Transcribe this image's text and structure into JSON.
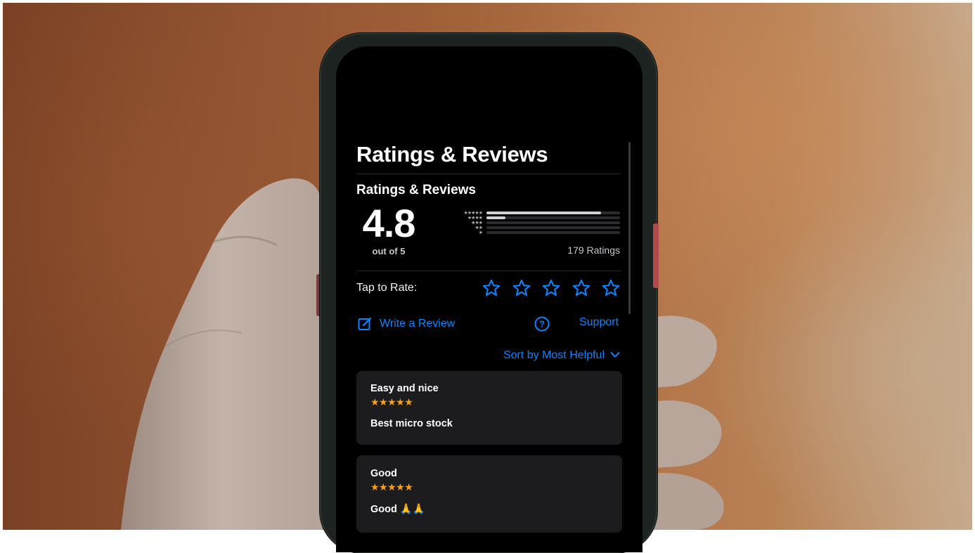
{
  "page": {
    "title": "Ratings & Reviews"
  },
  "ratings": {
    "section_title": "Ratings & Reviews",
    "average": "4.8",
    "out_of_label": "out of 5",
    "ratings_count": "179 Ratings",
    "distribution": [
      {
        "stars": 5,
        "fraction": 0.86
      },
      {
        "stars": 4,
        "fraction": 0.14
      },
      {
        "stars": 3,
        "fraction": 0.0
      },
      {
        "stars": 2,
        "fraction": 0.0
      },
      {
        "stars": 1,
        "fraction": 0.0
      }
    ]
  },
  "tap_to_rate": {
    "label": "Tap to Rate:",
    "star_count": 5
  },
  "actions": {
    "write_review": "Write a Review",
    "write_review_icon": "compose-icon",
    "support": "Support",
    "support_icon": "question-circle-icon"
  },
  "sort": {
    "label": "Sort by Most Helpful",
    "icon": "chevron-down-icon"
  },
  "reviews": [
    {
      "title": "Easy and nice",
      "stars": "★★★★★",
      "body": "Best micro stock"
    },
    {
      "title": "Good",
      "stars": "★★★★★",
      "body": "Good 🙏🙏"
    }
  ],
  "colors": {
    "accent": "#0a84ff",
    "star": "#ff9f0a",
    "screen_bg": "#000000",
    "card_bg": "#1c1c1e"
  }
}
